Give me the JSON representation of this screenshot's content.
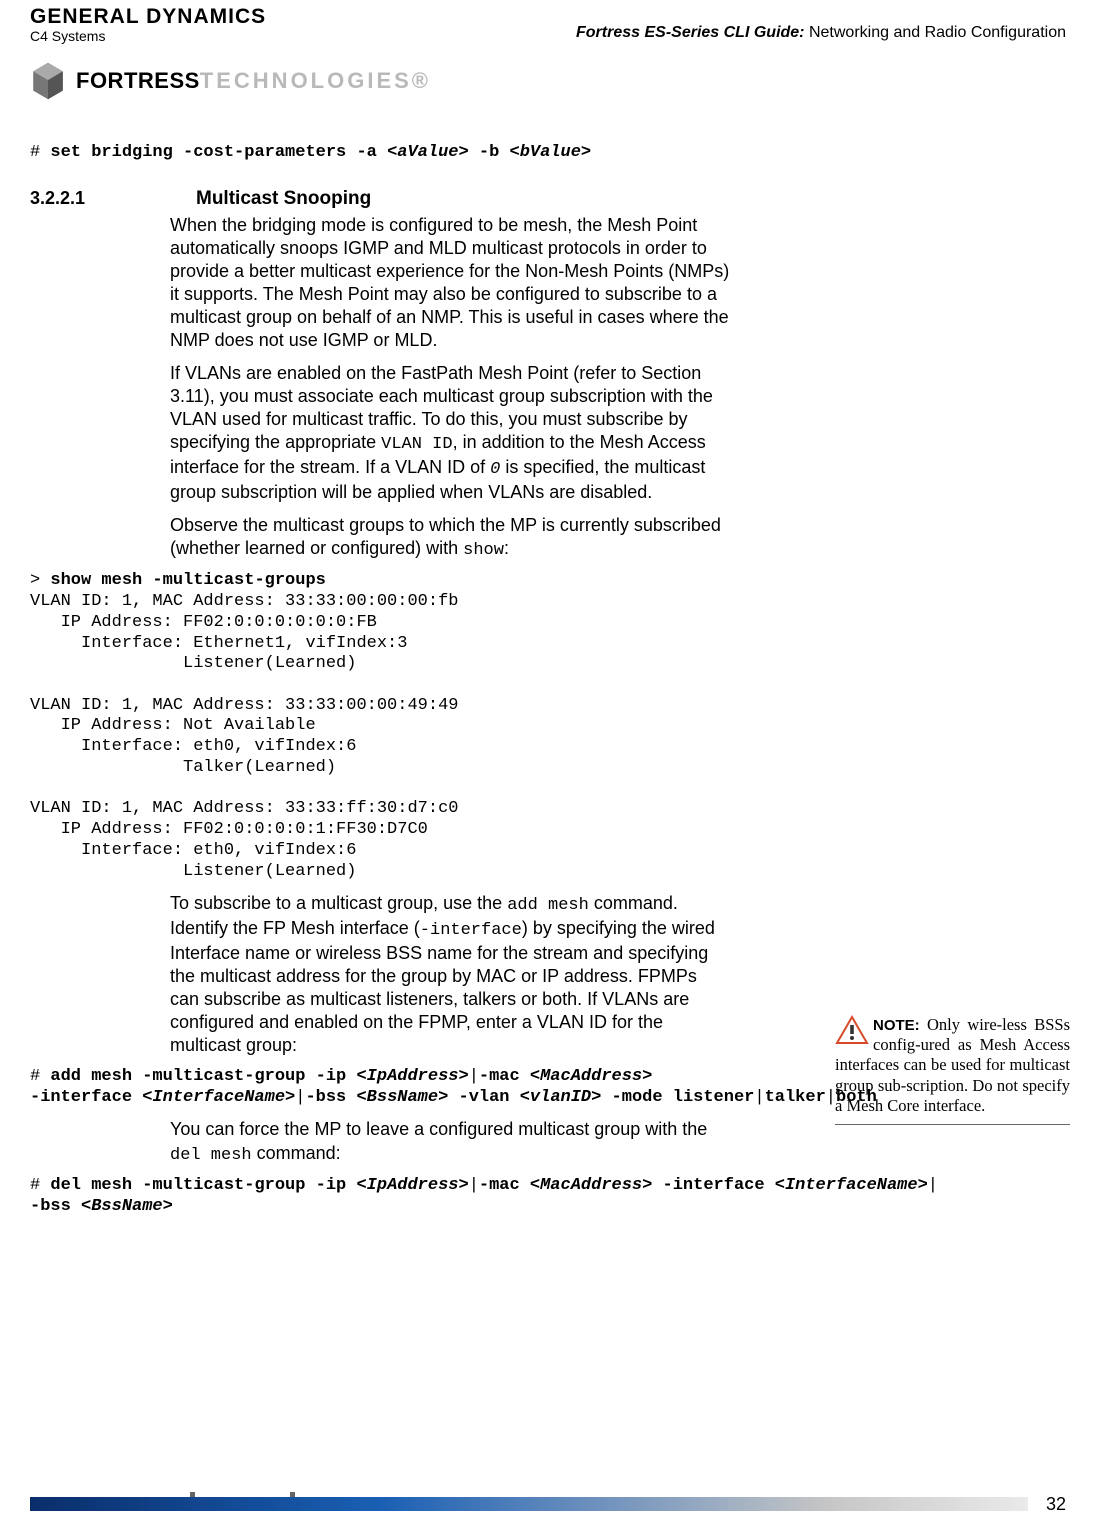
{
  "header": {
    "gd_line1": "GENERAL DYNAMICS",
    "gd_line2": "C4 Systems",
    "doc_title_bold": "Fortress ES-Series CLI Guide:",
    "doc_title_rest": " Networking and Radio Configuration",
    "fortress_word_bold": "FORTRESS",
    "fortress_word_light": "TECHNOLOGIES®"
  },
  "cli_top": {
    "prompt": "# ",
    "cmd1": "set bridging -cost-parameters -a ",
    "arg1": "<aValue>",
    "cmd2": " -b ",
    "arg2": "<bValue>"
  },
  "section": {
    "num": "3.2.2.1",
    "title": "Multicast Snooping"
  },
  "paras": {
    "p1": "When the bridging mode is configured to be mesh, the Mesh Point automatically snoops IGMP and MLD multicast protocols in order to provide a better multicast experience for the Non-Mesh Points (NMPs) it supports. The Mesh Point may also be configured to subscribe to a multicast group on behalf of an NMP. This is useful in cases where the NMP does not use IGMP or MLD.",
    "p2a": "If VLANs are enabled on the FastPath Mesh Point (refer to Section 3.11), you must associate each multicast group subscription with the VLAN used for multicast traffic. To do this, you must subscribe by specifying the appropriate ",
    "p2_code1": "VLAN ID",
    "p2b": ", in addition to the Mesh Access interface for the stream. If a VLAN ID of ",
    "p2_code2": "0",
    "p2c": " is specified, the multicast group subscription will be applied when VLANs are disabled.",
    "p3a": "Observe the multicast groups to which the MP is currently subscribed (whether learned or configured) with ",
    "p3_code": "show",
    "p3b": ":"
  },
  "cli_show": {
    "prompt": "> ",
    "cmd": "show mesh -multicast-groups",
    "out": "VLAN ID: 1, MAC Address: 33:33:00:00:00:fb\n   IP Address: FF02:0:0:0:0:0:0:FB\n     Interface: Ethernet1, vifIndex:3\n               Listener(Learned)\n\nVLAN ID: 1, MAC Address: 33:33:00:00:49:49\n   IP Address: Not Available\n     Interface: eth0, vifIndex:6\n               Talker(Learned)\n\nVLAN ID: 1, MAC Address: 33:33:ff:30:d7:c0\n   IP Address: FF02:0:0:0:0:1:FF30:D7C0\n     Interface: eth0, vifIndex:6\n               Listener(Learned)"
  },
  "paras2": {
    "p4a": "To subscribe to a multicast group, use the ",
    "p4_code1": "add mesh",
    "p4b": " command. Identify the FP Mesh interface (",
    "p4_code2": "-interface",
    "p4c": ") by specifying the wired Interface name or wireless BSS name for the stream and specifying the multicast address for the group by MAC or IP address. FPMPs can subscribe as multicast listeners, talkers or both. If VLANs are configured and enabled on the FPMP, enter a VLAN ID for the multicast group:"
  },
  "note": {
    "label": "NOTE:",
    "text": " Only wire-less BSSs config-ured as Mesh Access interfaces can be used for multicast group sub-scription. Do not specify a Mesh Core interface.",
    "top_px": "1015"
  },
  "cli_add": {
    "prompt": "# ",
    "c1": "add mesh -multicast-group -ip ",
    "a1": "<IpAddress>",
    "pipe1": "|",
    "c2": "-mac ",
    "a2": "<MacAddress>",
    "nl": "\n",
    "c3": "-interface ",
    "a3": "<InterfaceName>",
    "pipe2": "|",
    "c4": "-bss ",
    "a4": "<BssName>",
    "c5": " -vlan ",
    "a5": "<vlanID>",
    "c6": " -mode listener",
    "pipe3": "|",
    "c7": "talker",
    "pipe4": "|",
    "c8": "both"
  },
  "paras3": {
    "p5a": "You can force the MP to leave a configured multicast group with the ",
    "p5_code": "del mesh",
    "p5b": " command:"
  },
  "cli_del": {
    "prompt": "# ",
    "c1": "del mesh -multicast-group -ip ",
    "a1": "<IpAddress>",
    "pipe1": "|",
    "c2": "-mac ",
    "a2": "<MacAddress>",
    "c3": " -interface ",
    "a3": "<InterfaceName>",
    "pipe2": "|",
    "nl": "\n",
    "c4": "-bss ",
    "a4": "<BssName>"
  },
  "footer": {
    "page": "32"
  }
}
